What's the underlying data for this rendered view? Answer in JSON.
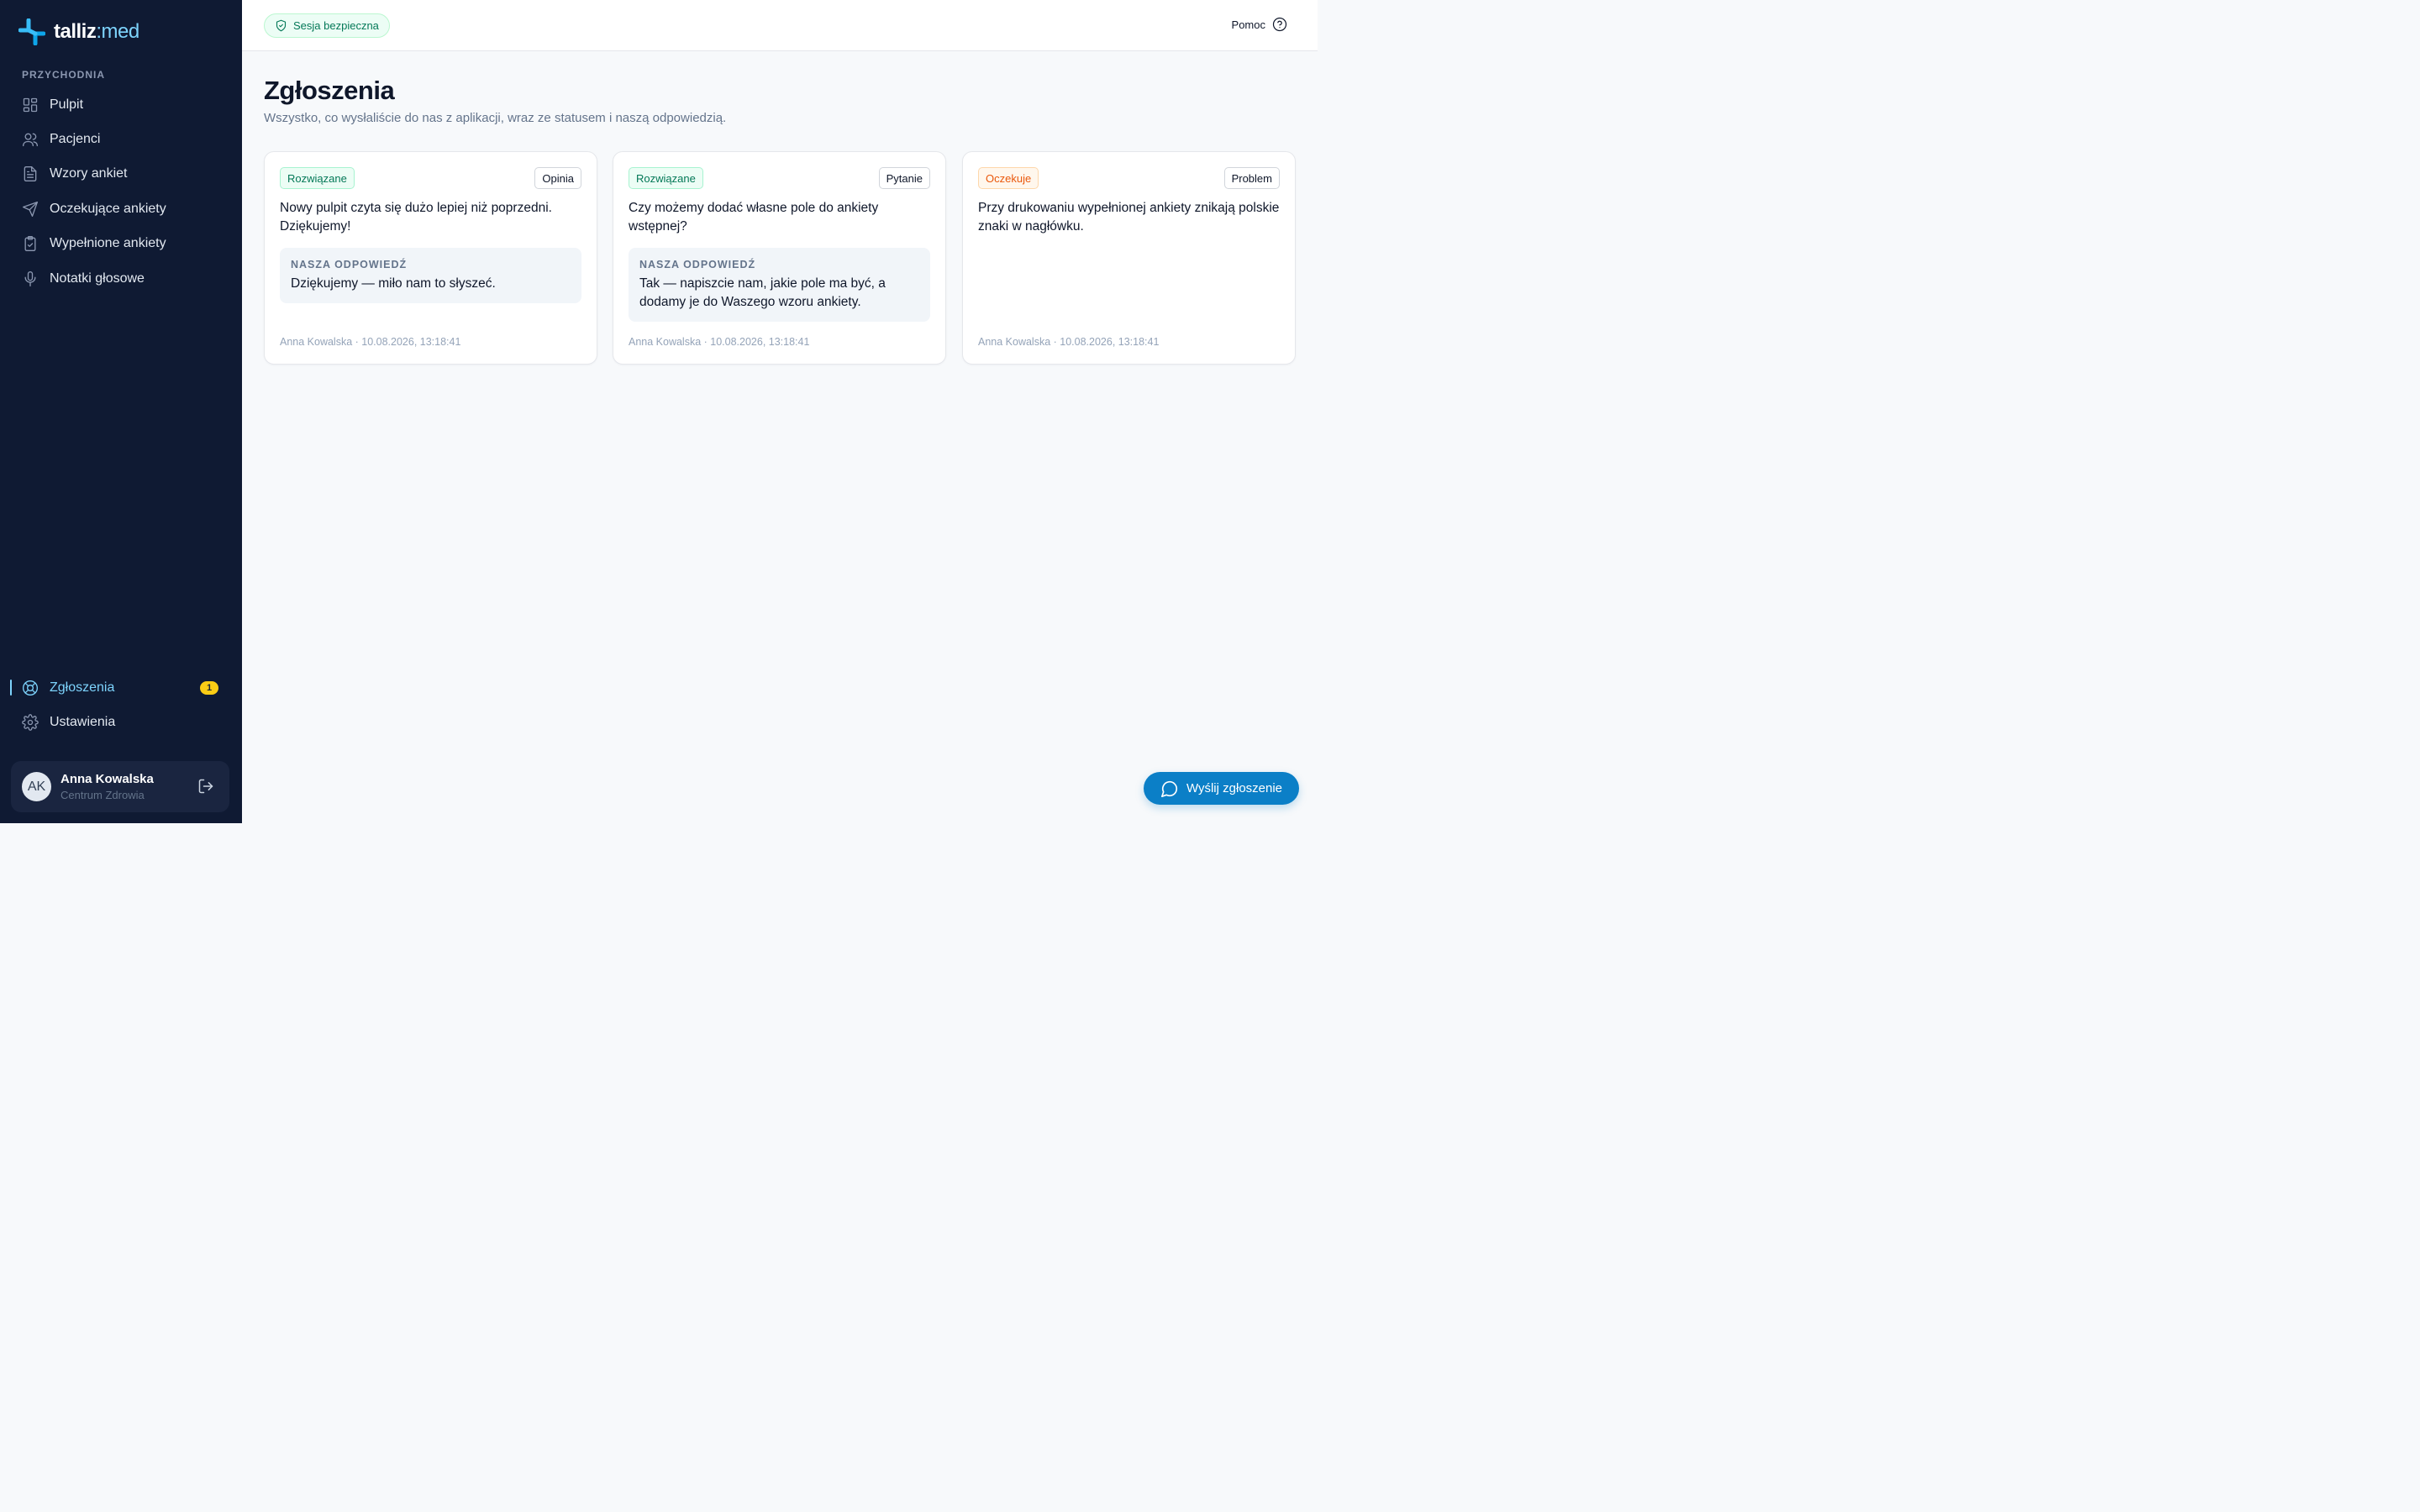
{
  "brand": {
    "name_a": "talliz",
    "name_sep": ":",
    "name_b": "med"
  },
  "sidebar": {
    "section_label": "PRZYCHODNIA",
    "items": [
      {
        "label": "Pulpit",
        "icon": "grid-icon"
      },
      {
        "label": "Pacjenci",
        "icon": "users-icon"
      },
      {
        "label": "Wzory ankiet",
        "icon": "document-icon"
      },
      {
        "label": "Oczekujące ankiety",
        "icon": "send-icon"
      },
      {
        "label": "Wypełnione ankiety",
        "icon": "clipboard-check-icon"
      },
      {
        "label": "Notatki głosowe",
        "icon": "mic-icon"
      }
    ],
    "bottom_items": [
      {
        "label": "Zgłoszenia",
        "icon": "lifebuoy-icon",
        "badge": "1",
        "active": true
      },
      {
        "label": "Ustawienia",
        "icon": "gear-icon"
      }
    ],
    "user": {
      "initials": "AK",
      "name": "Anna Kowalska",
      "org": "Centrum Zdrowia"
    }
  },
  "topbar": {
    "secure_label": "Sesja bezpieczna",
    "help_label": "Pomoc"
  },
  "main": {
    "title": "Zgłoszenia",
    "subtitle": "Wszystko, co wysłaliście do nas z aplikacji, wraz ze statusem i naszą odpowiedzią.",
    "reply_label": "NASZA ODPOWIEDŹ",
    "cards": [
      {
        "status": "Rozwiązane",
        "type": "Opinia",
        "text": "Nowy pulpit czyta się dużo lepiej niż poprzedni. Dziękujemy!",
        "reply": "Dziękujemy — miło nam to słyszeć.",
        "meta": "Anna Kowalska · 10.08.2026, 13:18:41"
      },
      {
        "status": "Rozwiązane",
        "type": "Pytanie",
        "text": "Czy możemy dodać własne pole do ankiety wstępnej?",
        "reply": "Tak — napiszcie nam, jakie pole ma być, a dodamy je do Waszego wzoru ankiety.",
        "meta": "Anna Kowalska · 10.08.2026, 13:18:41"
      },
      {
        "status": "Oczekuje",
        "type": "Problem",
        "text": "Przy drukowaniu wypełnionej ankiety znikają polskie znaki w nagłówku.",
        "meta": "Anna Kowalska · 10.08.2026, 13:18:41"
      }
    ]
  },
  "fab": {
    "label": "Wyślij zgłoszenie"
  },
  "colors": {
    "sidebar_bg": "#0f1a33",
    "accent": "#7dd3fc",
    "primary": "#0b7fc7",
    "success": "#047857",
    "warning": "#ea580c",
    "badge": "#facc15"
  }
}
